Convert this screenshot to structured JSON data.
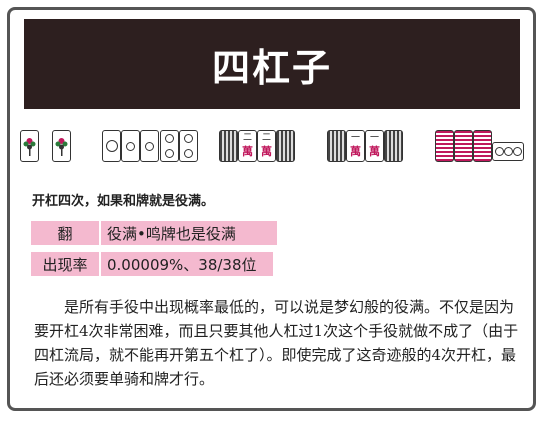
{
  "title": "四杠子",
  "tiles": {
    "hand_tile_glyphs": [
      "二",
      "萬",
      "一",
      "萬"
    ]
  },
  "intro": "开杠四次，如果和牌就是役满。",
  "info_rows": [
    {
      "label": "翻",
      "value": "役满•鸣牌也是役满"
    },
    {
      "label": "出现率",
      "value": "0.00009%、38/38位"
    }
  ],
  "description": "是所有手役中出现概率最低的，可以说是梦幻般的役满。不仅是因为要开杠4次非常困难，而且只要其他人杠过1次这个手役就做不成了（由于四杠流局，就不能再开第五个杠了）。即使完成了这奇迹般的4次开杠，最后还必须要单骑和牌才行。",
  "colors": {
    "title_bg": "#2d1f1f",
    "highlight": "#f4b9cf",
    "wan_red": "#c0185c"
  }
}
